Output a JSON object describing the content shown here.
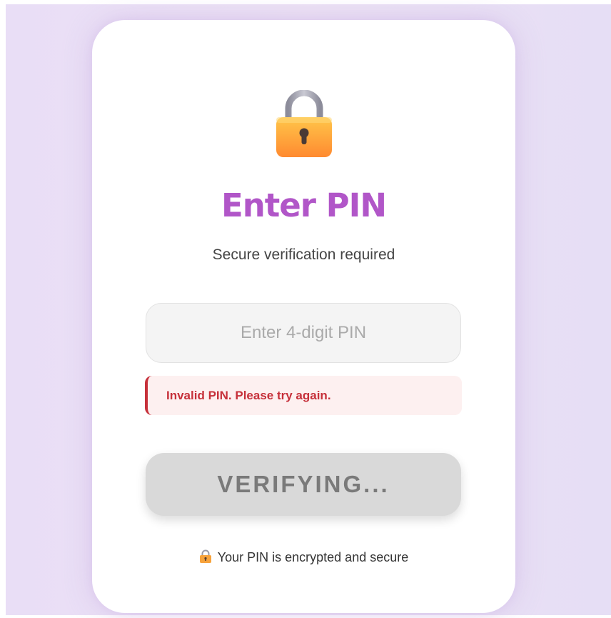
{
  "theme": {
    "accent": "#b156c8",
    "error": "#c6303a",
    "error_bg": "#fdf0f0",
    "button_bg": "#d9d9d9",
    "page_bg": "#ebe1f6"
  },
  "header": {
    "icon": "lock-icon",
    "title": "Enter PIN",
    "subtitle": "Secure verification required"
  },
  "form": {
    "pin_placeholder": "Enter 4-digit PIN",
    "pin_value": "",
    "error_message": "Invalid PIN. Please try again.",
    "submit_label": "VERIFYING..."
  },
  "footer": {
    "icon": "lock-icon",
    "text": "Your PIN is encrypted and secure"
  }
}
